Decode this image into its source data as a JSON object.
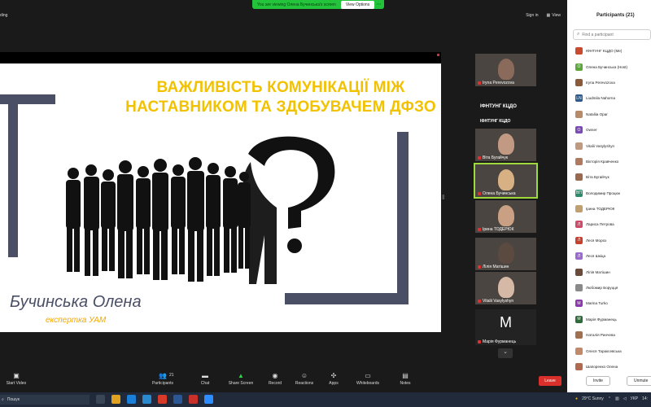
{
  "window": {
    "left_label": "ding",
    "share_banner": "You are viewing Олена Бучинська's screen",
    "view_options": "View Options",
    "sign_in": "Sign in",
    "view": "View"
  },
  "slide": {
    "title_line1": "ВАЖЛИВІСТЬ КОМУНІКАЦІЇ МІЖ",
    "title_line2": "НАСТАВНИКОМ ТА ЗДОБУВАЧЕМ ДФЗО",
    "author": "Бучинська Олена",
    "author_role": "експертка УАМ"
  },
  "gallery": {
    "tiles": [
      {
        "label": "Iryna Perevozova",
        "kind": "video",
        "face": "#8a6a5a"
      },
      {
        "label": "ІФНТУНГ КЦДО",
        "kind": "name"
      },
      {
        "label": "ІФНТУНГ КЦДО",
        "kind": "banner"
      },
      {
        "label": "Віта Бугайчук",
        "kind": "video",
        "face": "#c29a84"
      },
      {
        "label": "Олена Бучинська",
        "kind": "video",
        "face": "#d7b184",
        "active": true
      },
      {
        "label": "Ірина ТОДЕРЮК",
        "kind": "video",
        "face": "#c9a083"
      },
      {
        "label": "Лілія Матішин",
        "kind": "video",
        "face": "#5a4a40"
      },
      {
        "label": "Vitalii Vasylyshyn",
        "kind": "video",
        "face": "#d6b8a6"
      },
      {
        "label": "Марія Фурманець",
        "kind": "letter",
        "letter": "M"
      }
    ]
  },
  "participants": {
    "title": "Participants (21)",
    "search_placeholder": "Find a participant",
    "list": [
      {
        "name": "ІФНТУНГ КЦДО (Me)",
        "initial": "",
        "color": "#c94a2e"
      },
      {
        "name": "Олена Бучинська (Host)",
        "initial": "О",
        "color": "#5aa83a"
      },
      {
        "name": "Iryna Perevozova",
        "initial": "",
        "color": "#8a5a3a"
      },
      {
        "name": "Liudmila Nahorna",
        "initial": "LN",
        "color": "#2e5a8a"
      },
      {
        "name": "Nataliia Opar",
        "initial": "",
        "color": "#b78a6a"
      },
      {
        "name": "Owner",
        "initial": "O",
        "color": "#7a4ab5"
      },
      {
        "name": "Vitalii Vasylyshyn",
        "initial": "",
        "color": "#c09a80"
      },
      {
        "name": "Вікторія Кравченко",
        "initial": "",
        "color": "#b07a60"
      },
      {
        "name": "Віта Бугайчук",
        "initial": "",
        "color": "#9a6a50"
      },
      {
        "name": "Володимир Процюк",
        "initial": "ВП",
        "color": "#2e8a6a"
      },
      {
        "name": "Ірина ТОДЕРЮК",
        "initial": "",
        "color": "#c0a070"
      },
      {
        "name": "Лариса Петрова",
        "initial": "Л",
        "color": "#d04a6a"
      },
      {
        "name": "Леся Мороз",
        "initial": "Л",
        "color": "#c8402e"
      },
      {
        "name": "Леся Шкіца",
        "initial": "Л",
        "color": "#9a6ad0"
      },
      {
        "name": "Лілія Матішин",
        "initial": "",
        "color": "#6a4a3a"
      },
      {
        "name": "Любомир Боруцця",
        "initial": "",
        "color": "#8a8a8a"
      },
      {
        "name": "Marina Turko",
        "initial": "M",
        "color": "#8a3aa8"
      },
      {
        "name": "Марія Фурманець",
        "initial": "M",
        "color": "#2e6a3a"
      },
      {
        "name": "Наталія Ринчева",
        "initial": "",
        "color": "#a07050"
      },
      {
        "name": "Олеся Тараксевська",
        "initial": "",
        "color": "#c08a6a"
      },
      {
        "name": "Шапоренко Олена",
        "initial": "",
        "color": "#b06a50"
      }
    ],
    "invite": "Invite",
    "unmute_all": "Unmute"
  },
  "toolbar": {
    "start_video": "Start Video",
    "participants": "Participants",
    "participants_count": "21",
    "chat": "Chat",
    "share_screen": "Share Screen",
    "record": "Record",
    "reactions": "Reactions",
    "apps": "Apps",
    "whiteboards": "Whiteboards",
    "notes": "Notes",
    "leave": "Leave"
  },
  "taskbar": {
    "search": "Пошук",
    "weather": "29°C Sunny",
    "lang": "УКР",
    "clock": "14:"
  }
}
